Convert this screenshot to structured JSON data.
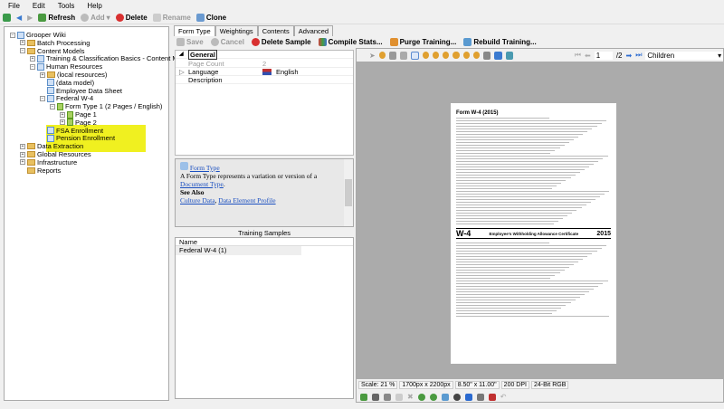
{
  "menu": [
    "File",
    "Edit",
    "Tools",
    "Help"
  ],
  "toolbar": {
    "refresh": "Refresh",
    "add": "Add",
    "delete": "Delete",
    "rename": "Rename",
    "clone": "Clone"
  },
  "tree": [
    {
      "label": "Grooper Wiki",
      "depth": 0,
      "icon": "database"
    },
    {
      "label": "Batch Processing",
      "depth": 1,
      "icon": "folder"
    },
    {
      "label": "Content Models",
      "depth": 1,
      "icon": "folder"
    },
    {
      "label": "Training & Classification Basics - Content Model",
      "depth": 2,
      "icon": "content-model"
    },
    {
      "label": "Human Resources",
      "depth": 2,
      "icon": "content-model"
    },
    {
      "label": "(local resources)",
      "depth": 3,
      "icon": "folder"
    },
    {
      "label": "(data model)",
      "depth": 3,
      "icon": "data-model"
    },
    {
      "label": "Employee Data Sheet",
      "depth": 3,
      "icon": "document-type"
    },
    {
      "label": "Federal W-4",
      "depth": 3,
      "icon": "document-type"
    },
    {
      "label": "Form Type 1 (2 Pages / English)",
      "depth": 4,
      "icon": "form-type"
    },
    {
      "label": "Page 1",
      "depth": 5,
      "icon": "page"
    },
    {
      "label": "Page 2",
      "depth": 5,
      "icon": "page"
    },
    {
      "label": "FSA Enrollment",
      "depth": 3,
      "icon": "document-type"
    },
    {
      "label": "Pension Enrollment",
      "depth": 3,
      "icon": "document-type"
    },
    {
      "label": "Data Extraction",
      "depth": 1,
      "icon": "folder"
    },
    {
      "label": "Global Resources",
      "depth": 1,
      "icon": "folder"
    },
    {
      "label": "Infrastructure",
      "depth": 1,
      "icon": "folder"
    },
    {
      "label": "Reports",
      "depth": 1,
      "icon": "folder"
    }
  ],
  "tabs": [
    "Form Type",
    "Weightings",
    "Contents",
    "Advanced"
  ],
  "form_toolbar": {
    "save": "Save",
    "cancel": "Cancel",
    "delete_sample": "Delete Sample",
    "compile": "Compile Stats...",
    "purge": "Purge Training...",
    "rebuild": "Rebuild Training..."
  },
  "props": {
    "section": "General",
    "page_count_label": "Page Count",
    "page_count": "2",
    "language_label": "Language",
    "language": "English",
    "description_label": "Description"
  },
  "help": {
    "title": "Form Type",
    "text": "A Form Type represents a variation or version of a",
    "link": "Document Type",
    "see_also": "See Also",
    "links": [
      "Culture Data",
      "Data Element Profile"
    ]
  },
  "samples": {
    "title": "Training Samples",
    "header": "Name",
    "rows": [
      "Federal W-4 (1)"
    ]
  },
  "viewer": {
    "page": "1",
    "total": "/2",
    "mode": "Children"
  },
  "document": {
    "title": "Form W-4 (2015)",
    "form_id": "W-4",
    "heading": "Employee's Withholding Allowance Certificate",
    "year": "2015"
  },
  "status": [
    "Scale: 21 %",
    "1700px x 2200px",
    "8.50\" x 11.00\"",
    "200 DPI",
    "24-Bit RGB"
  ]
}
